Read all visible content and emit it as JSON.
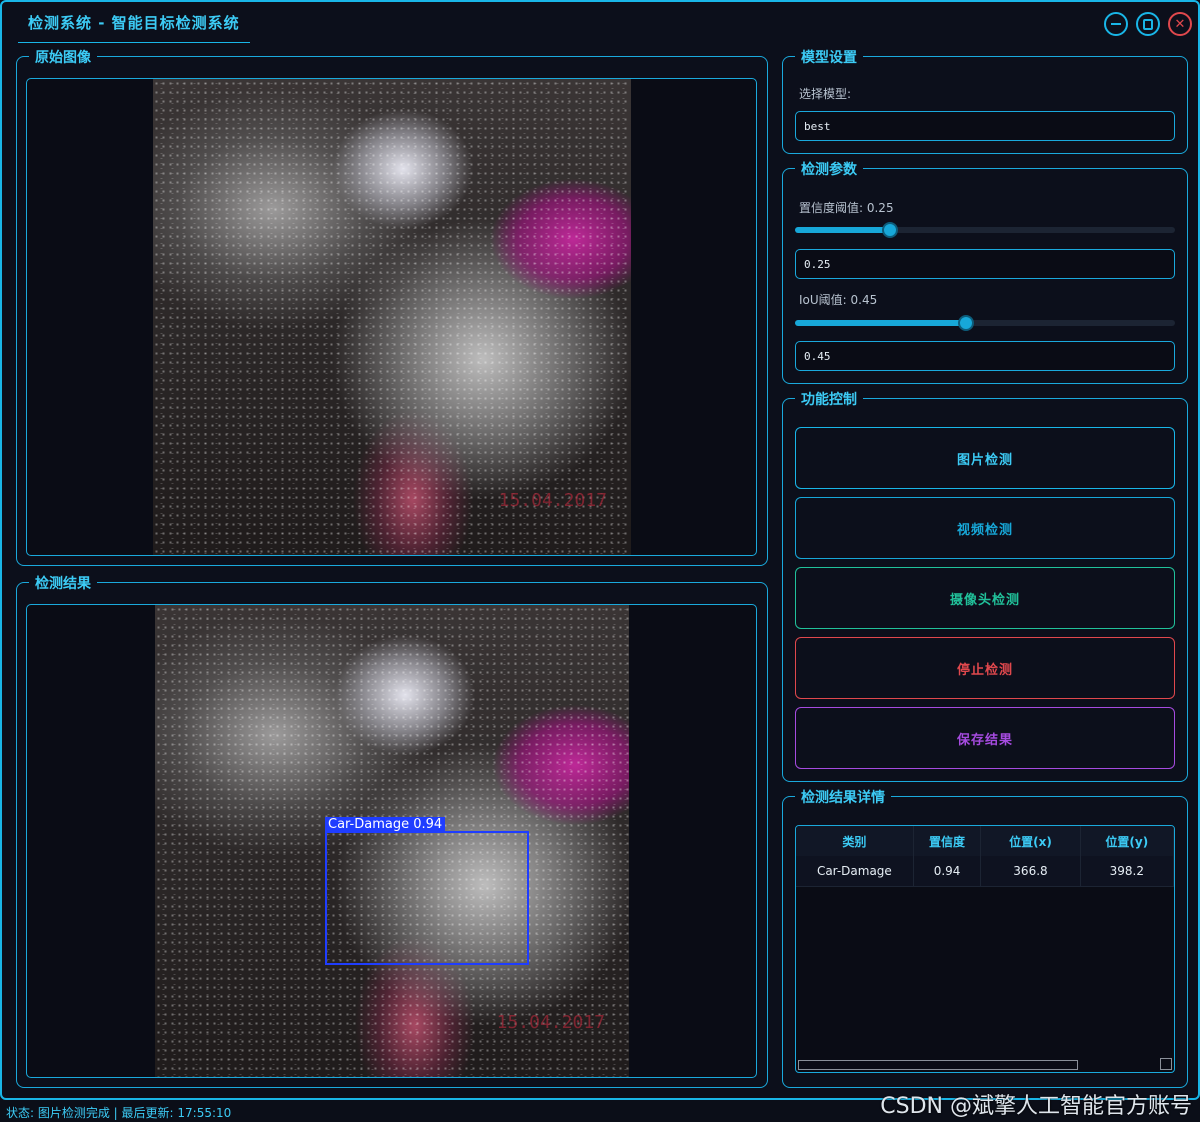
{
  "window": {
    "title": "检测系统 - 智能目标检测系统",
    "minimize_icon": "minimize-icon",
    "maximize_icon": "maximize-icon",
    "close_icon": "close-icon"
  },
  "original_image": {
    "title": "原始图像",
    "date_stamp": "15.04.2017"
  },
  "result_image": {
    "title": "检测结果",
    "date_stamp": "15.04.2017",
    "detection_label": "Car-Damage 0.94"
  },
  "model_settings": {
    "title": "模型设置",
    "select_label": "选择模型:",
    "selected_model": "best"
  },
  "detect_params": {
    "title": "检测参数",
    "conf_label": "置信度阈值: 0.25",
    "conf_value": "0.25",
    "conf_level": 0.25,
    "iou_label": "IoU阈值: 0.45",
    "iou_value": "0.45",
    "iou_level": 0.45
  },
  "controls": {
    "title": "功能控制",
    "image_detect": "图片检测",
    "video_detect": "视频检测",
    "camera_detect": "摄像头检测",
    "stop_detect": "停止检测",
    "save_result": "保存结果"
  },
  "results_detail": {
    "title": "检测结果详情",
    "columns": [
      "类别",
      "置信度",
      "位置(x)",
      "位置(y)"
    ],
    "rows": [
      [
        "Car-Damage",
        "0.94",
        "366.8",
        "398.2"
      ]
    ]
  },
  "status_bar": "状态: 图片检测完成 | 最后更新: 17:55:10",
  "watermark": "CSDN @斌擎人工智能官方账号",
  "colors": {
    "accent": "#19b6e8",
    "video_btn": "#17a7d8",
    "camera_btn": "#21c19a",
    "stop_btn": "#e0484d",
    "save_btn": "#a64be0",
    "detect_box": "#1f3dff"
  }
}
